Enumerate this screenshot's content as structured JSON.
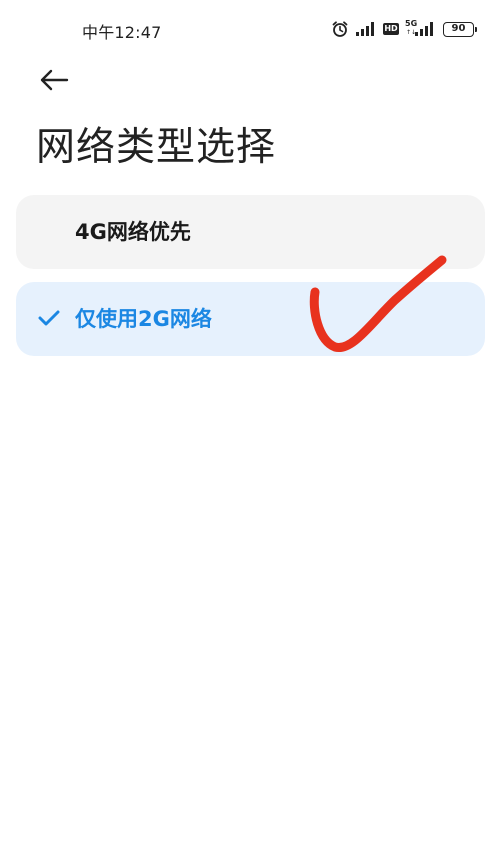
{
  "status_bar": {
    "time": "中午12:47",
    "network_tag": "5G",
    "battery_level": "90",
    "hd_label": "HD"
  },
  "header": {
    "title": "网络类型选择"
  },
  "options": [
    {
      "label": "4G网络优先",
      "selected": false
    },
    {
      "label": "仅使用2G网络",
      "selected": true
    }
  ],
  "colors": {
    "accent": "#1b87e3",
    "selected_bg": "#e6f1fd",
    "unselected_bg": "#f4f4f4",
    "annotation_stroke": "#e8321e"
  },
  "icons": [
    "alarm-icon",
    "signal-icon",
    "hd-icon",
    "5g-signal-icon",
    "battery-icon",
    "back-arrow-icon",
    "check-icon"
  ]
}
